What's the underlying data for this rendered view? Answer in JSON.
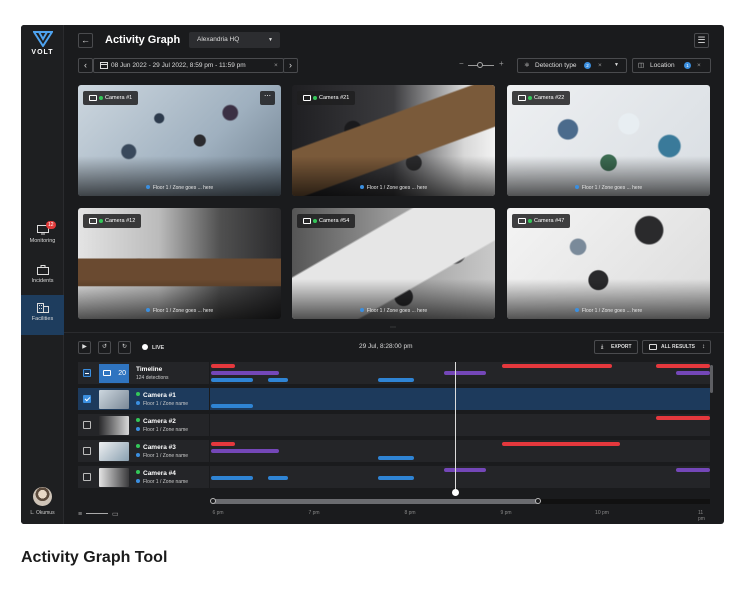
{
  "app": {
    "logo_text": "VOLT",
    "page_title": "Activity Graph",
    "location_select": "Alexandria HQ",
    "date_range": "08 Jun 2022 - 29 Jul 2022, 8:59 pm - 11:59 pm",
    "filters": [
      {
        "label": "Detection type",
        "count": "2"
      },
      {
        "label": "Location",
        "count": "1"
      }
    ],
    "colors": {
      "accent": "#3b8fe0",
      "red": "#e5383d",
      "purple": "#7447b8",
      "live_green": "#34c759"
    }
  },
  "sidebar": {
    "items": [
      {
        "label": "Monitoring",
        "icon": "monitor-icon",
        "badge": "12"
      },
      {
        "label": "Incidents",
        "icon": "briefcase-icon"
      },
      {
        "label": "Facilities",
        "icon": "building-icon",
        "active": true
      }
    ],
    "user_name": "L. Okumus"
  },
  "cameras": [
    {
      "name": "Camera #1",
      "zone": "Floor 1 / Zone goes ... here",
      "has_menu": true
    },
    {
      "name": "Camera #21",
      "zone": "Floor 1 / Zone goes ... here"
    },
    {
      "name": "Camera #22",
      "zone": "Floor 1 / Zone goes ... here"
    },
    {
      "name": "Camera #12",
      "zone": "Floor 1 / Zone goes ... here"
    },
    {
      "name": "Camera #54",
      "zone": "Floor 1 / Zone goes ... here"
    },
    {
      "name": "Camera #47",
      "zone": "Floor 1 / Zone goes ... here"
    }
  ],
  "player": {
    "live_label": "LIVE",
    "current_time": "29 Jul, 8:28:00 pm",
    "export_label": "EXPORT",
    "results_label": "ALL RESULTS"
  },
  "timeline": {
    "summary": {
      "title": "Timeline",
      "detections": "124 detections",
      "count": "20"
    },
    "rows": [
      {
        "name": "Camera #1",
        "zone": "Floor 1 / Zone name",
        "checked": true
      },
      {
        "name": "Camera #2",
        "zone": "Floor 1 / Zone name",
        "checked": false
      },
      {
        "name": "Camera #3",
        "zone": "Floor 1 / Zone name",
        "checked": false
      },
      {
        "name": "Camera #4",
        "zone": "Floor 1 / Zone name",
        "checked": false
      }
    ],
    "ticks": [
      "6 pm",
      "7 pm",
      "8 pm",
      "9 pm",
      "10 pm",
      "11 pm"
    ]
  },
  "caption": "Activity Graph Tool"
}
